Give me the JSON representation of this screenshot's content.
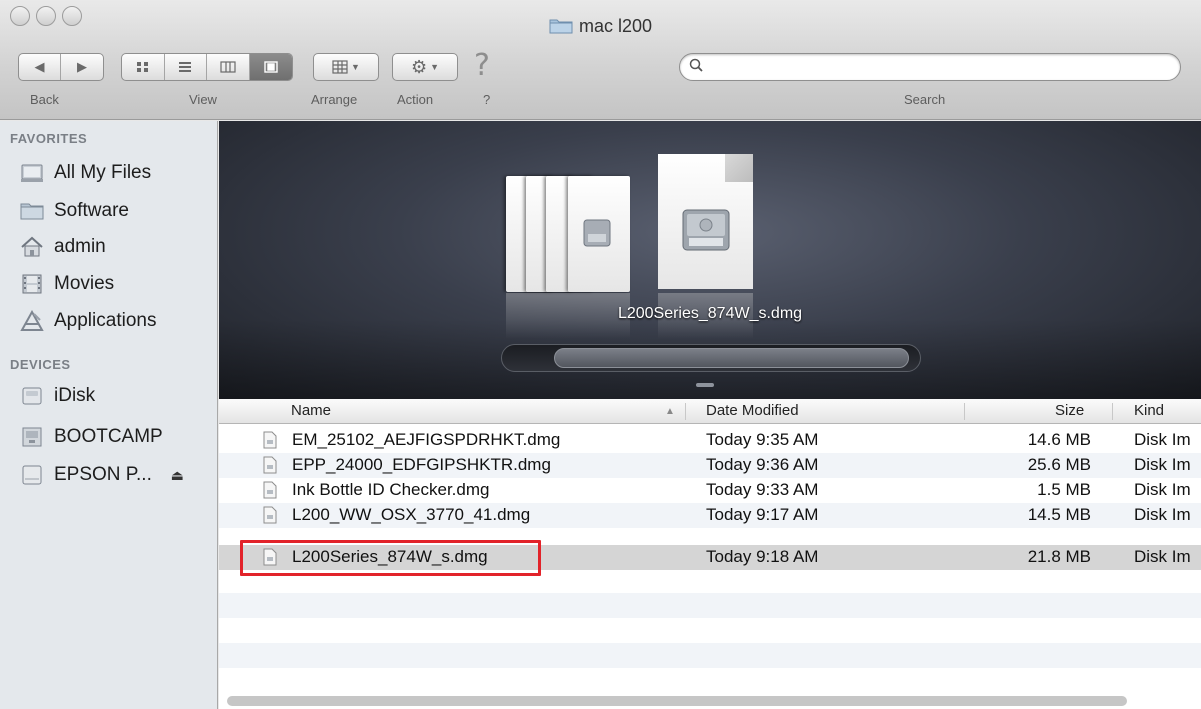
{
  "window": {
    "title": "mac l200"
  },
  "toolbar": {
    "back_label": "Back",
    "view_label": "View",
    "arrange_label": "Arrange",
    "action_label": "Action",
    "help_label": "?",
    "help_glyph": "?",
    "search_label": "Search",
    "search_value": ""
  },
  "sidebar": {
    "favorites_header": "FAVORITES",
    "favorites": [
      {
        "label": "All My Files",
        "icon": "all-my-files-icon"
      },
      {
        "label": "Software",
        "icon": "folder-icon"
      },
      {
        "label": "admin",
        "icon": "home-icon"
      },
      {
        "label": "Movies",
        "icon": "movies-icon"
      },
      {
        "label": "Applications",
        "icon": "applications-icon"
      }
    ],
    "devices_header": "DEVICES",
    "devices": [
      {
        "label": "iDisk",
        "icon": "idisk-icon"
      },
      {
        "label": "BOOTCAMP",
        "icon": "drive-icon"
      },
      {
        "label": "EPSON P...",
        "icon": "drive-icon",
        "eject": "⏏"
      }
    ]
  },
  "coverflow": {
    "selected_name": "L200Series_874W_s.dmg",
    "scroll_position": 0.88
  },
  "list": {
    "columns": {
      "name": "Name",
      "date": "Date Modified",
      "size": "Size",
      "kind": "Kind"
    },
    "rows": [
      {
        "name": "EM_25102_AEJFIGSPDRHKT.dmg",
        "date": "Today 9:35 AM",
        "size": "14.6 MB",
        "kind": "Disk Im"
      },
      {
        "name": "EPP_24000_EDFGIPSHKTR.dmg",
        "date": "Today 9:36 AM",
        "size": "25.6 MB",
        "kind": "Disk Im"
      },
      {
        "name": "Ink Bottle ID Checker.dmg",
        "date": "Today 9:33 AM",
        "size": "1.5 MB",
        "kind": "Disk Im"
      },
      {
        "name": "L200_WW_OSX_3770_41.dmg",
        "date": "Today 9:17 AM",
        "size": "14.5 MB",
        "kind": "Disk Im"
      },
      {
        "name": "L200Series_874W_s.dmg",
        "date": "Today 9:18 AM",
        "size": "21.8 MB",
        "kind": "Disk Im",
        "selected": true
      }
    ]
  },
  "colors": {
    "highlight": "#e2232a",
    "selection": "#d5d5d5",
    "sidebar_bg": "#e4e8ec"
  }
}
